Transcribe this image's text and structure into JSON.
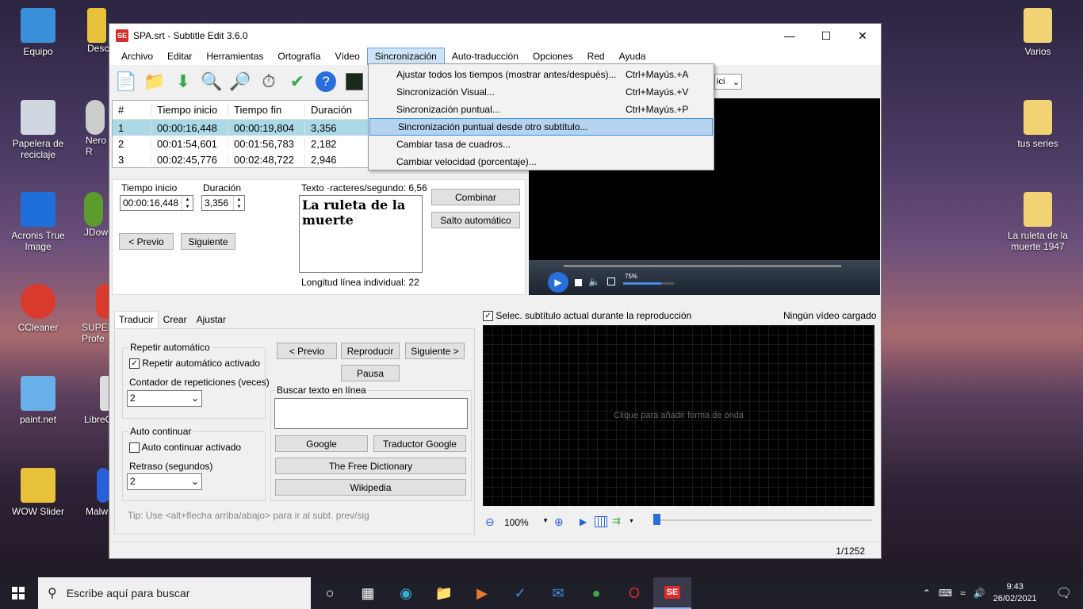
{
  "desktop": {
    "icons": [
      {
        "label": "Equipo",
        "color": "#3a8fd9"
      },
      {
        "label": "Papelera de reciclaje",
        "color": "#cfd8e0"
      },
      {
        "label": "Acronis True Image",
        "color": "#1e6fd9"
      },
      {
        "label": "CCleaner",
        "color": "#d93a2b"
      },
      {
        "label": "paint.net",
        "color": "#6ab0e8"
      },
      {
        "label": "WOW Slider",
        "color": "#e8c23a"
      },
      {
        "label": "Desc",
        "color": "#e8c23a"
      },
      {
        "label": "Nero R",
        "color": "#ccc"
      },
      {
        "label": "JDown",
        "color": "#5c9c2f"
      },
      {
        "label": "SUPER Profe",
        "color": "#d93a2b"
      },
      {
        "label": "LibreO",
        "color": "#ddd"
      },
      {
        "label": "Malw",
        "color": "#2a5fd9"
      },
      {
        "label": "Varios",
        "color": "#f2d374"
      },
      {
        "label": "tus series",
        "color": "#f2d374"
      },
      {
        "label": "La ruleta de la muerte 1947",
        "color": "#f2d374"
      }
    ]
  },
  "window": {
    "title": "SPA.srt - Subtitle Edit 3.6.0",
    "app_icon": "SE"
  },
  "menu": [
    "Archivo",
    "Editar",
    "Herramientas",
    "Ortografía",
    "Vídeo",
    "Sincronización",
    "Auto-traducción",
    "Opciones",
    "Red",
    "Ayuda"
  ],
  "grid": {
    "headers": [
      "#",
      "Tiempo inicio",
      "Tiempo fin",
      "Duración"
    ],
    "rows": [
      [
        "1",
        "00:00:16,448",
        "00:00:19,804",
        "3,356"
      ],
      [
        "2",
        "00:01:54,601",
        "00:01:56,783",
        "2,182"
      ],
      [
        "3",
        "00:02:45,776",
        "00:02:48,722",
        "2,946"
      ]
    ]
  },
  "edit": {
    "start_label": "Tiempo inicio",
    "start_value": "00:00:16,448",
    "dur_label": "Duración",
    "dur_value": "3,356",
    "text_label": "Texto ·racteres/segundo: 6,56",
    "text": "La ruleta de la muerte",
    "line_len": "Longitud línea individual: 22",
    "prev": "< Previo",
    "next": "Siguiente",
    "combine": "Combinar",
    "auto_break": "Salto automático"
  },
  "dropdown": [
    {
      "label": "Ajustar todos los tiempos (mostrar antes/después)...",
      "shortcut": "Ctrl+Mayús.+A"
    },
    {
      "label": "Sincronización Visual...",
      "shortcut": "Ctrl+Mayús.+V"
    },
    {
      "label": "Sincronización puntual...",
      "shortcut": "Ctrl+Mayús.+P"
    },
    {
      "label": "Sincronización puntual desde otro subtítulo...",
      "shortcut": ""
    },
    {
      "label": "Cambiar tasa de cuadros...",
      "shortcut": ""
    },
    {
      "label": "Cambiar velocidad (porcentaje)...",
      "shortcut": ""
    }
  ],
  "toolbar_combo": "ici",
  "tabs": [
    "Traducir",
    "Crear",
    "Ajustar"
  ],
  "translate": {
    "repeat_group": "Repetir automático",
    "repeat_chk": "Repetir automático activado",
    "repeat_count": "Contador de repeticiones (veces)",
    "repeat_val": "2",
    "auto_group": "Auto continuar",
    "auto_chk": "Auto continuar activado",
    "delay": "Retraso (segundos)",
    "delay_val": "2",
    "prev": "< Previo",
    "play": "Reproducir",
    "next": "Siguiente >",
    "pause": "Pausa",
    "search_group": "Buscar texto en línea",
    "google": "Google",
    "gtranslate": "Traductor Google",
    "dict": "The Free Dictionary",
    "wiki": "Wikipedia",
    "tip": "Tip: Use <alt+flecha arriba/abajo> para ir al subt. prev/sig"
  },
  "video": {
    "volume": "75%",
    "sel_chk": "Selec. subtítulo actual durante la reproducción",
    "no_video": "Ningún vídeo cargado",
    "wave_hint": "Clique para añadir forma de onda",
    "zoom": "100%"
  },
  "status": "1/1252",
  "taskbar": {
    "search": "Escribe aquí para buscar",
    "time": "9:43",
    "date": "26/02/2021"
  }
}
